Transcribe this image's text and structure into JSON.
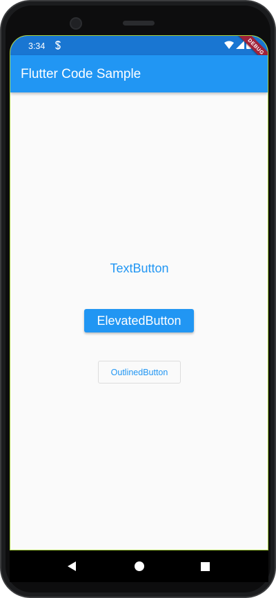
{
  "status_bar": {
    "time": "3:34",
    "icons": [
      "s-notification-icon",
      "wifi-icon",
      "signal-icon",
      "battery-icon"
    ]
  },
  "app_bar": {
    "title": "Flutter Code Sample"
  },
  "debug_banner": {
    "label": "DEBUG"
  },
  "buttons": {
    "text_button": "TextButton",
    "elevated_button": "ElevatedButton",
    "outlined_button": "OutlinedButton"
  },
  "navigation": {
    "icons": [
      "back-icon",
      "home-icon",
      "recents-icon"
    ]
  },
  "colors": {
    "primary": "#2196f3",
    "status_bar": "#1976d2",
    "background": "#fafafa",
    "debug_banner": "#a0223a"
  }
}
